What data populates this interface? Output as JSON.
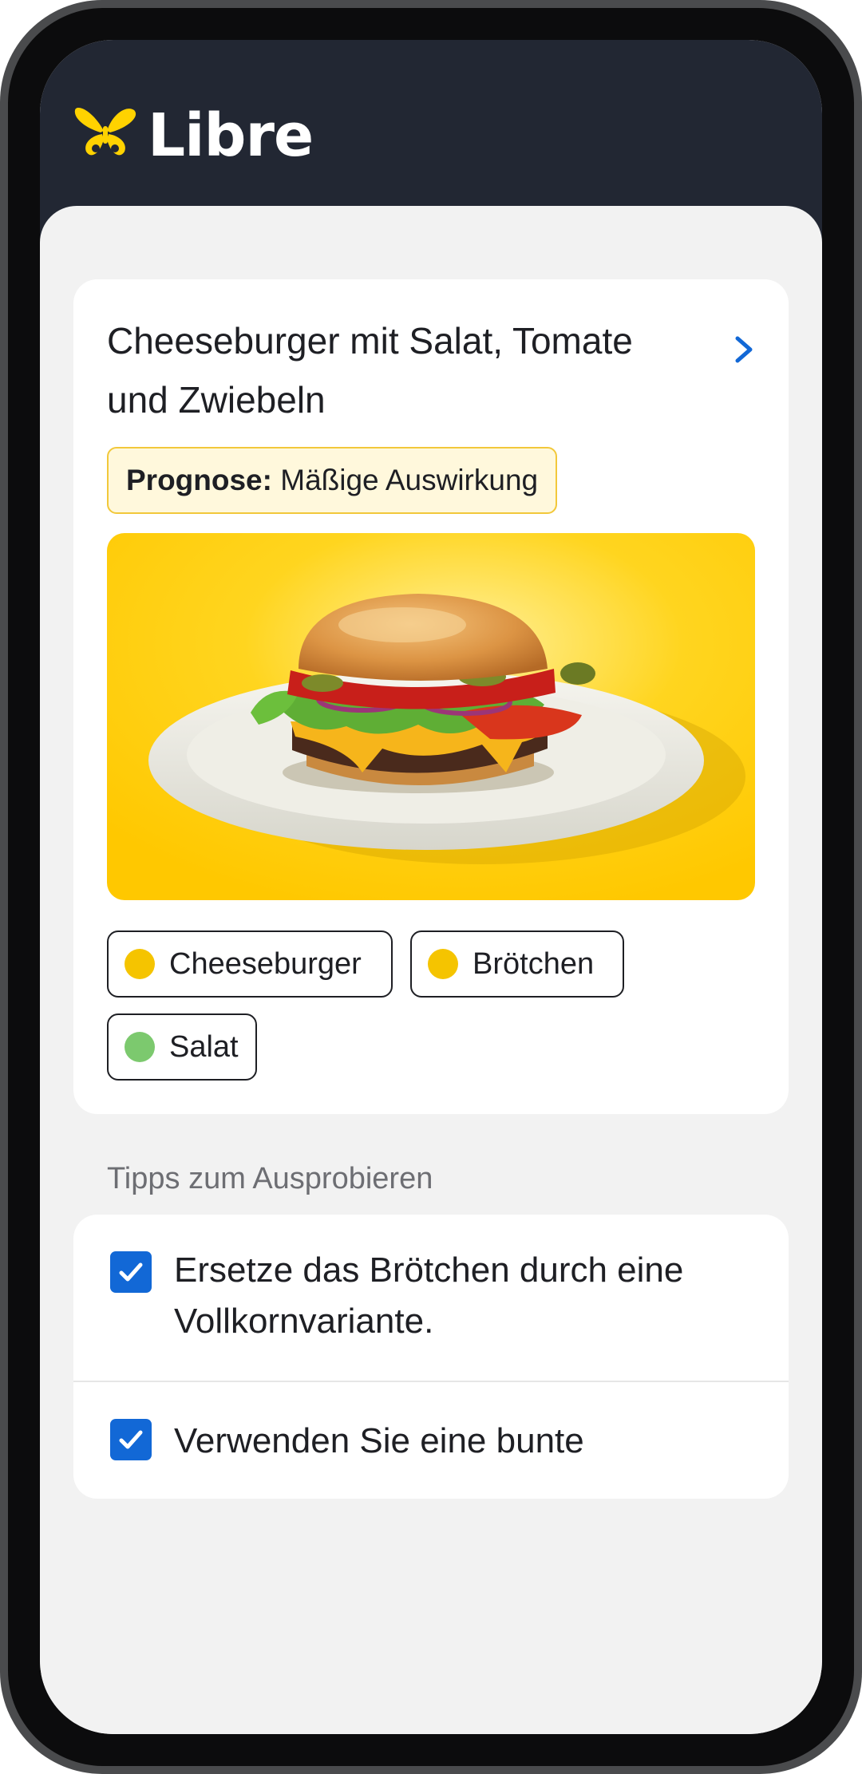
{
  "app": {
    "brand": "Libre",
    "brand_color": "#FFD200",
    "header_color": "#222733"
  },
  "meal": {
    "title": "Cheeseburger mit Salat, Tomate und Zwiebeln",
    "prognosis_label": "Prognose:",
    "prognosis_value": "Mäßige Auswirkung",
    "image_icon": "cheeseburger-photo",
    "components": [
      {
        "label": "Cheeseburger",
        "color": "#F5C400"
      },
      {
        "label": "Brötchen",
        "color": "#F5C400"
      },
      {
        "label": "Salat",
        "color": "#7CC96E"
      }
    ]
  },
  "tips": {
    "section_label": "Tipps zum Ausprobieren",
    "items": [
      {
        "text": "Ersetze das Brötchen durch eine Vollkornvariante.",
        "checked": true
      },
      {
        "text": "Verwenden Sie eine bunte",
        "checked": true
      }
    ],
    "check_color": "#1268D6"
  }
}
